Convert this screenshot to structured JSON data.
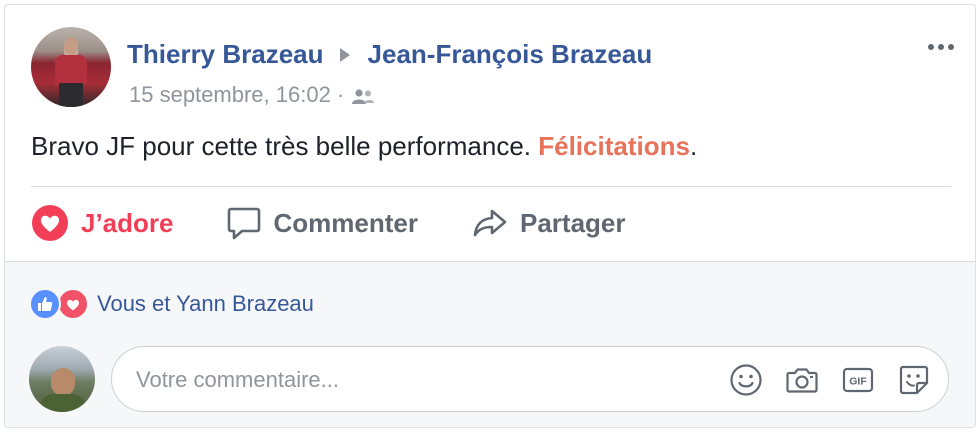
{
  "post": {
    "author": "Thierry Brazeau",
    "target": "Jean-François Brazeau",
    "timestamp": "15 septembre, 16:02",
    "separator": "·",
    "audience_icon": "friends-icon",
    "text_before": "Bravo JF pour cette très belle performance. ",
    "mention": "Félicitations",
    "text_after": "."
  },
  "actions": {
    "love_label": "J’adore",
    "comment_label": "Commenter",
    "share_label": "Partager"
  },
  "reactions": {
    "summary": "Vous et Yann Brazeau",
    "types": [
      "like-icon",
      "love-icon"
    ]
  },
  "comment": {
    "placeholder": "Votre commentaire...",
    "tools": [
      "emoji-icon",
      "camera-icon",
      "gif-icon",
      "sticker-icon"
    ]
  },
  "colors": {
    "link_blue": "#365899",
    "love_red": "#f33e58",
    "mention_orange": "#e9725a",
    "muted_gray": "#90949c",
    "like_blue": "#5890ff"
  }
}
